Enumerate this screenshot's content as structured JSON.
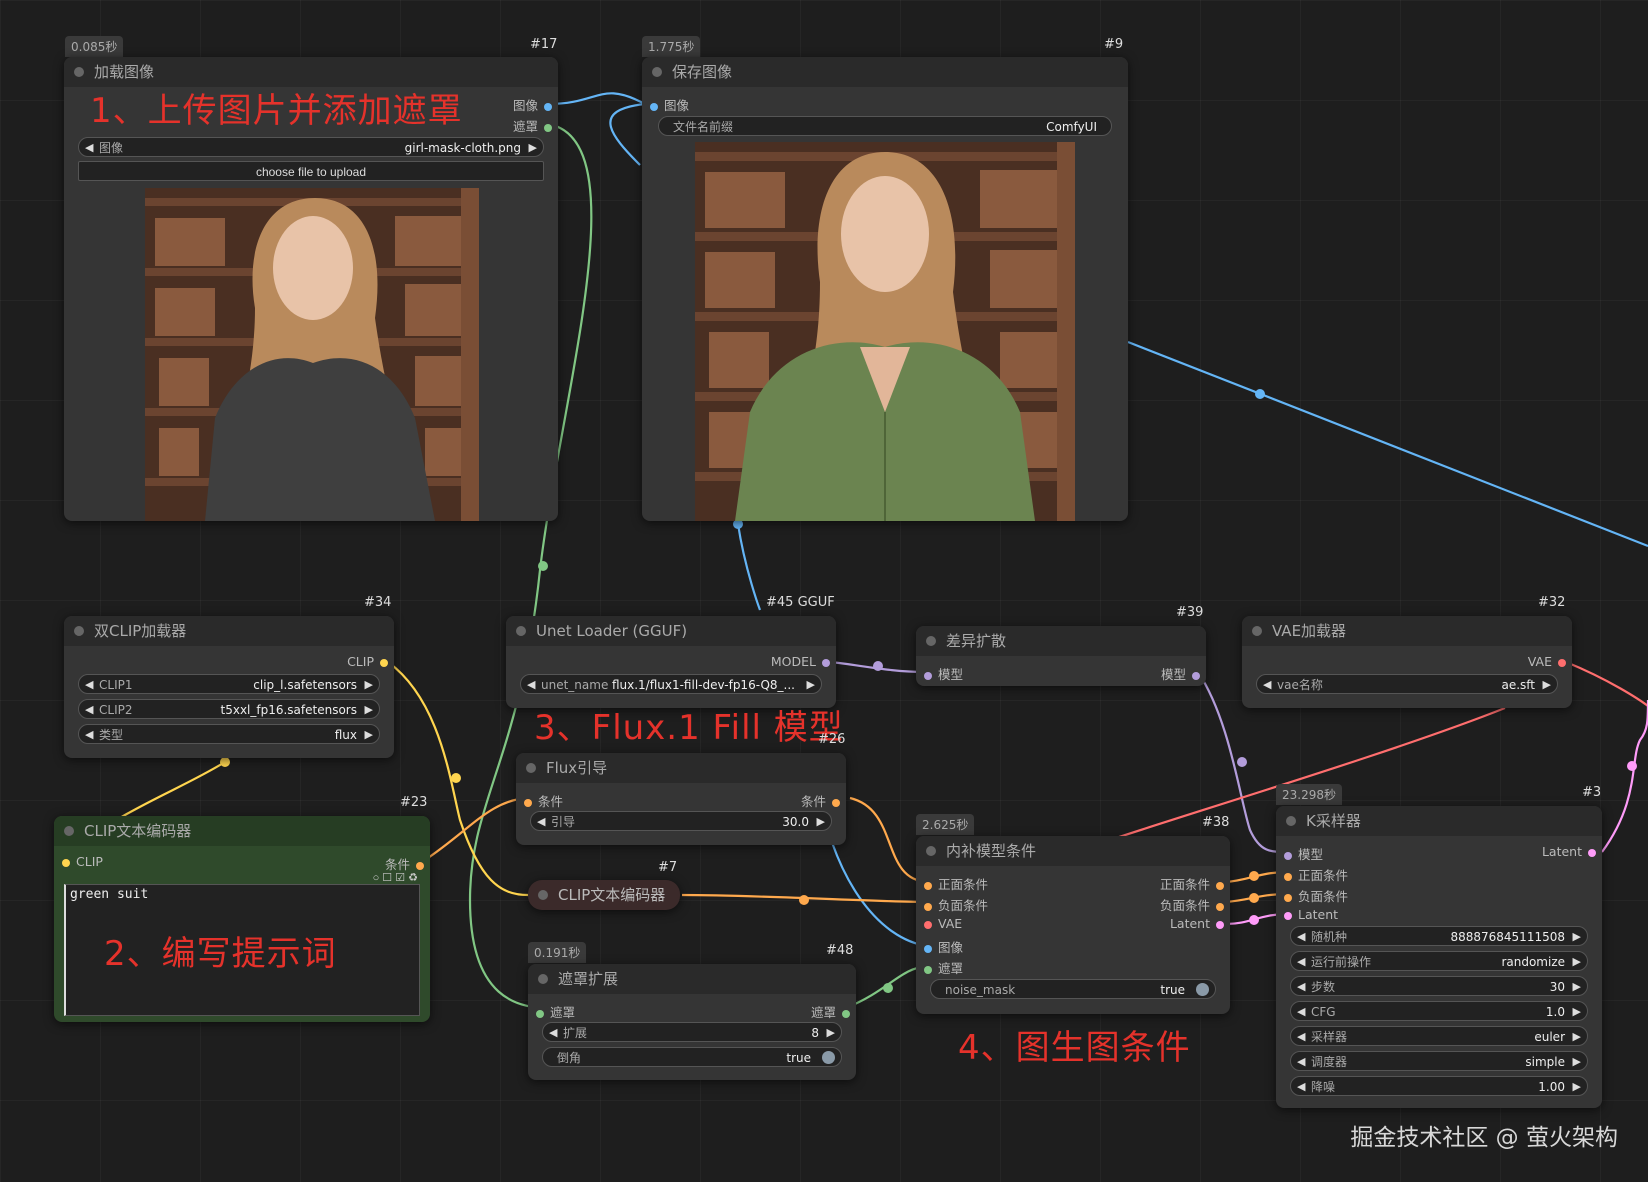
{
  "nodes": {
    "load_image": {
      "time": "0.085秒",
      "id": "#17",
      "title": "加载图像",
      "outputs": [
        "图像",
        "遮罩"
      ],
      "image_widget_label": "图像",
      "image_widget_value": "girl-mask-cloth.png",
      "upload_button": "choose file to upload"
    },
    "save_image": {
      "time": "1.775秒",
      "id": "#9",
      "title": "保存图像",
      "input": "图像",
      "prefix_label": "文件名前缀",
      "prefix_value": "ComfyUI"
    },
    "dual_clip": {
      "id": "#34",
      "title": "双CLIP加载器",
      "output": "CLIP",
      "widgets": [
        {
          "label": "CLIP1",
          "value": "clip_l.safetensors"
        },
        {
          "label": "CLIP2",
          "value": "t5xxl_fp16.safetensors"
        },
        {
          "label": "类型",
          "value": "flux"
        }
      ]
    },
    "unet_loader": {
      "id": "#45 GGUF",
      "title": "Unet Loader (GGUF)",
      "output": "MODEL",
      "widget_label": "unet_name",
      "widget_value": "flux.1/flux1-fill-dev-fp16-Q8_..."
    },
    "diff_diffusion": {
      "id": "#39",
      "title": "差异扩散",
      "input": "模型",
      "output": "模型"
    },
    "vae_loader": {
      "id": "#32",
      "title": "VAE加载器",
      "output": "VAE",
      "widget_label": "vae名称",
      "widget_value": "ae.sft"
    },
    "flux_guidance": {
      "id": "#26",
      "title": "Flux引导",
      "input": "条件",
      "output": "条件",
      "widget_label": "引导",
      "widget_value": "30.0"
    },
    "clip_text_positive": {
      "id": "#23",
      "title": "CLIP文本编码器",
      "input": "CLIP",
      "output": "条件",
      "text": "green suit"
    },
    "clip_text_negative": {
      "id": "#7",
      "title": "CLIP文本编码器"
    },
    "inpaint_conditioning": {
      "time": "2.625秒",
      "id": "#38",
      "title": "内补模型条件",
      "inputs": [
        "正面条件",
        "负面条件",
        "VAE",
        "图像",
        "遮罩"
      ],
      "outputs": [
        "正面条件",
        "负面条件",
        "Latent"
      ],
      "widget_label": "noise_mask",
      "widget_value": "true"
    },
    "grow_mask": {
      "time": "0.191秒",
      "id": "#48",
      "title": "遮罩扩展",
      "input": "遮罩",
      "output": "遮罩",
      "widgets": [
        {
          "label": "扩展",
          "value": "8"
        },
        {
          "label": "倒角",
          "value": "true"
        }
      ]
    },
    "ksampler": {
      "time": "23.298秒",
      "id": "#3",
      "title": "K采样器",
      "inputs": [
        "模型",
        "正面条件",
        "负面条件",
        "Latent"
      ],
      "output": "Latent",
      "widgets": [
        {
          "label": "随机种",
          "value": "888876845111508"
        },
        {
          "label": "运行前操作",
          "value": "randomize"
        },
        {
          "label": "步数",
          "value": "30"
        },
        {
          "label": "CFG",
          "value": "1.0"
        },
        {
          "label": "采样器",
          "value": "euler"
        },
        {
          "label": "调度器",
          "value": "simple"
        },
        {
          "label": "降噪",
          "value": "1.00"
        }
      ]
    }
  },
  "annotations": {
    "a1": "1、上传图片并添加遮罩",
    "a2": "2、编写提示词",
    "a3": "3、Flux.1 Fill 模型",
    "a4": "4、图生图条件"
  },
  "watermark": "掘金技术社区 @ 萤火架构",
  "colors": {
    "image": "#64b5f6",
    "mask": "#81c784",
    "clip": "#ffd54f",
    "conditioning": "#ffa94d",
    "model": "#b39ddb",
    "vae": "#ff6e6e",
    "latent": "#ff9cf9",
    "annotation": "#e5322b",
    "node_green": "#2f4a2b"
  }
}
